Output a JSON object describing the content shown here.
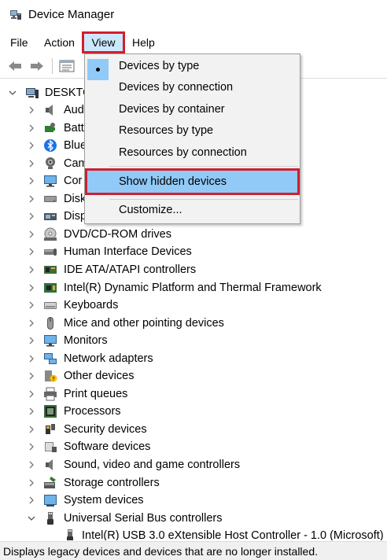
{
  "window": {
    "title": "Device Manager"
  },
  "menubar": {
    "file": "File",
    "action": "Action",
    "view": "View",
    "help": "Help"
  },
  "toolbar": {
    "back_icon": "back-arrow-icon",
    "forward_icon": "forward-arrow-icon",
    "properties_icon": "properties-grid-icon"
  },
  "view_menu": {
    "items": [
      {
        "label": "Devices by type",
        "checked": true
      },
      {
        "label": "Devices by connection"
      },
      {
        "label": "Devices by container"
      },
      {
        "label": "Resources by type"
      },
      {
        "label": "Resources by connection"
      },
      {
        "label": "Show hidden devices",
        "highlighted": true
      },
      {
        "label": "Customize..."
      }
    ]
  },
  "tree": {
    "root": "DESKTOP",
    "items": [
      {
        "label": "Aud",
        "icon": "speaker-icon"
      },
      {
        "label": "Batt",
        "icon": "battery-icon"
      },
      {
        "label": "Blue",
        "icon": "bluetooth-icon"
      },
      {
        "label": "Cam",
        "icon": "webcam-icon"
      },
      {
        "label": "Cor",
        "icon": "monitor-icon"
      },
      {
        "label": "Disk",
        "icon": "disk-drive-icon"
      },
      {
        "label": "Disp",
        "icon": "display-adapter-icon"
      },
      {
        "label": "DVD/CD-ROM drives",
        "icon": "dvd-drive-icon"
      },
      {
        "label": "Human Interface Devices",
        "icon": "hid-icon"
      },
      {
        "label": "IDE ATA/ATAPI controllers",
        "icon": "ide-controller-icon"
      },
      {
        "label": "Intel(R) Dynamic Platform and Thermal Framework",
        "icon": "chip-icon"
      },
      {
        "label": "Keyboards",
        "icon": "keyboard-icon"
      },
      {
        "label": "Mice and other pointing devices",
        "icon": "mouse-icon"
      },
      {
        "label": "Monitors",
        "icon": "monitor-icon"
      },
      {
        "label": "Network adapters",
        "icon": "network-adapter-icon"
      },
      {
        "label": "Other devices",
        "icon": "unknown-device-icon"
      },
      {
        "label": "Print queues",
        "icon": "printer-icon"
      },
      {
        "label": "Processors",
        "icon": "processor-icon"
      },
      {
        "label": "Security devices",
        "icon": "security-key-icon"
      },
      {
        "label": "Software devices",
        "icon": "software-device-icon"
      },
      {
        "label": "Sound, video and game controllers",
        "icon": "speaker-icon"
      },
      {
        "label": "Storage controllers",
        "icon": "storage-controller-icon"
      },
      {
        "label": "System devices",
        "icon": "system-device-icon"
      },
      {
        "label": "Universal Serial Bus controllers",
        "icon": "usb-icon",
        "expanded": true
      }
    ],
    "child": "Intel(R) USB 3.0 eXtensible Host Controller - 1.0 (Microsoft)"
  },
  "status": {
    "text": "Displays legacy devices and devices that are no longer installed."
  },
  "colors": {
    "accent_highlight": "#91c9f7",
    "annotation_red": "#d11f2d",
    "menu_bg": "#f2f2f2"
  }
}
